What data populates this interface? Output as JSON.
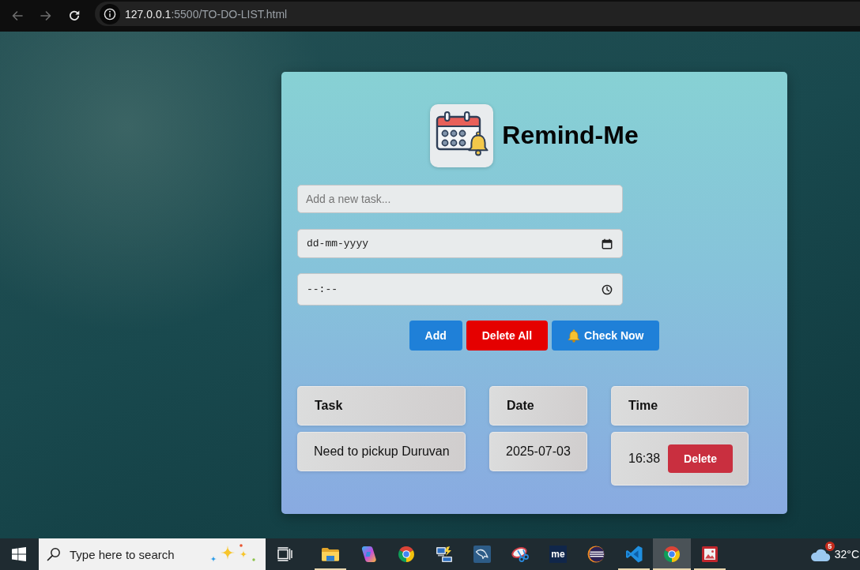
{
  "browser": {
    "nav": [
      {
        "kind": "back",
        "disabled": true
      },
      {
        "kind": "forward",
        "disabled": true
      },
      {
        "kind": "reload",
        "disabled": false
      }
    ],
    "address": {
      "host": "127.0.0.1",
      "path": ":5500/TO-DO-LIST.html"
    }
  },
  "app": {
    "title": "Remind-Me",
    "task_field": {
      "placeholder": "Add a new task..."
    },
    "date_field": {
      "placeholder": "dd-mm-yyyy"
    },
    "time_field": {
      "placeholder": "--:--"
    },
    "buttons": [
      {
        "label": "Add",
        "kind": "primary"
      },
      {
        "label": "Delete All",
        "kind": "danger"
      },
      {
        "label": "Check Now",
        "kind": "alert"
      }
    ],
    "table": {
      "columns": [
        "Task",
        "Date",
        "Time"
      ],
      "rows": [
        {
          "task": "Need to pickup Duruvan",
          "date": "2025-07-03",
          "time": "16:38",
          "action": "Delete"
        }
      ]
    }
  },
  "taskbar": {
    "search": {
      "placeholder": "Type here to search"
    },
    "apps": [
      {
        "kind": "folder",
        "running": true,
        "selected": false
      },
      {
        "kind": "swirl",
        "running": false,
        "selected": false
      },
      {
        "kind": "browser",
        "running": false,
        "selected": false
      },
      {
        "kind": "network",
        "running": false,
        "selected": false
      },
      {
        "kind": "dolphin",
        "running": false,
        "selected": false
      },
      {
        "kind": "scissors",
        "running": false,
        "selected": false
      },
      {
        "kind": "tile",
        "label": "me",
        "running": false,
        "selected": false
      },
      {
        "kind": "eclipse",
        "running": false,
        "selected": false
      },
      {
        "kind": "editor",
        "running": true,
        "selected": false
      },
      {
        "kind": "browser",
        "running": true,
        "selected": true
      },
      {
        "kind": "photo",
        "running": true,
        "selected": false
      }
    ],
    "weather": {
      "notifications": "5",
      "temperature": "32°C"
    }
  }
}
